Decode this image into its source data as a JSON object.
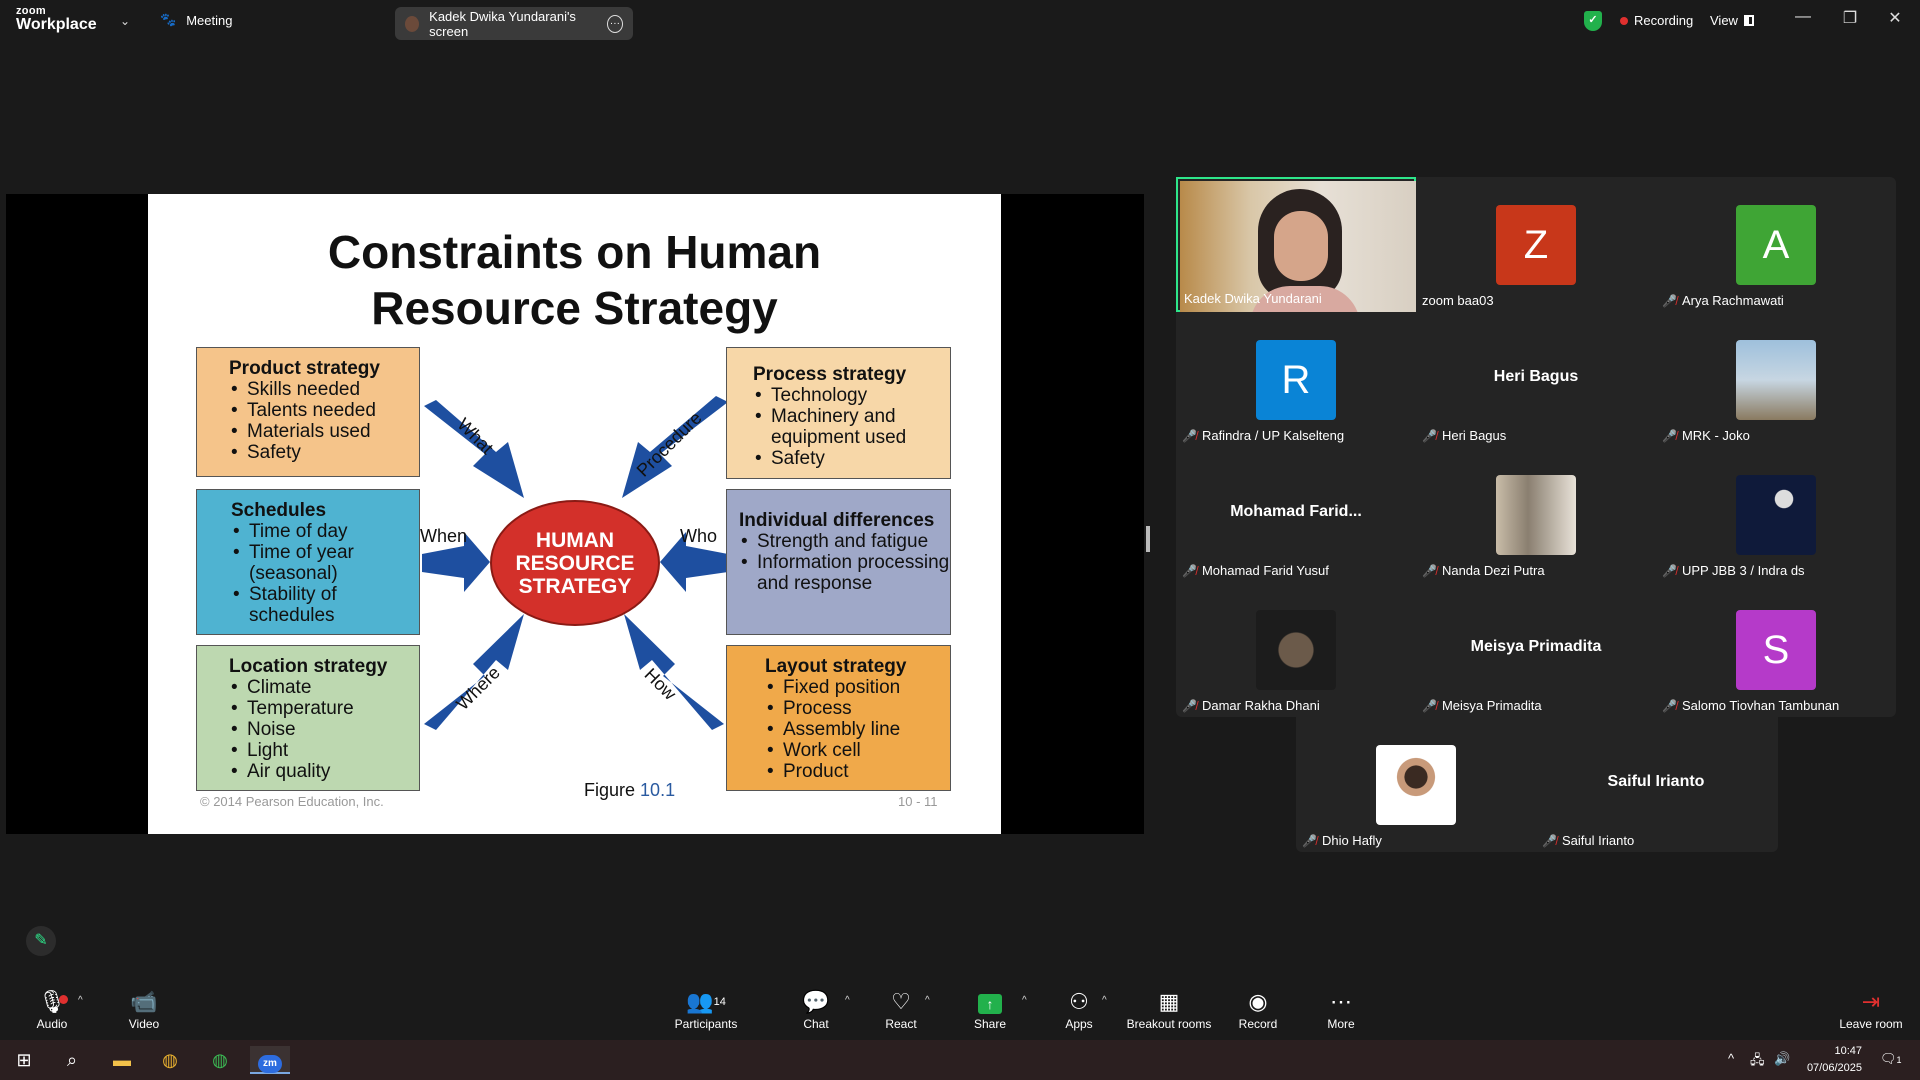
{
  "app": {
    "brand_top": "zoom",
    "brand_bottom": "Workplace",
    "meeting_label": "Meeting",
    "screen_label": "Kadek Dwika Yundarani's screen",
    "recording_label": "Recording",
    "view_label": "View"
  },
  "slide": {
    "title_line1": "Constraints on Human",
    "title_line2": "Resource Strategy",
    "hub_line1": "HUMAN",
    "hub_line2": "RESOURCE",
    "hub_line3": "STRATEGY",
    "arrows": {
      "what": "What",
      "procedure": "Procedure",
      "when": "When",
      "who": "Who",
      "where": "Where",
      "how": "How"
    },
    "boxes": {
      "product": {
        "title": "Product strategy",
        "items": [
          "Skills needed",
          "Talents needed",
          "Materials used",
          "Safety"
        ]
      },
      "schedules": {
        "title": "Schedules",
        "items": [
          "Time of day",
          "Time of year (seasonal)",
          "Stability of schedules"
        ]
      },
      "location": {
        "title": "Location strategy",
        "items": [
          "Climate",
          "Temperature",
          "Noise",
          "Light",
          "Air quality"
        ]
      },
      "process": {
        "title": "Process strategy",
        "items": [
          "Technology",
          "Machinery and equipment used",
          "Safety"
        ]
      },
      "individual": {
        "title": "Individual differences",
        "items": [
          "Strength and fatigue",
          "Information processing and response"
        ]
      },
      "layout": {
        "title": "Layout strategy",
        "items": [
          "Fixed position",
          "Process",
          "Assembly line",
          "Work cell",
          "Product"
        ]
      }
    },
    "colors": {
      "product": "#f5c48a",
      "schedules": "#4fb3d1",
      "location": "#bdd8b0",
      "process": "#f7d7a8",
      "individual": "#9fa8c8",
      "layout": "#f0a94a",
      "hub": "#d3302a",
      "arrows": "#1e4fa0"
    },
    "copyright": "© 2014 Pearson Education, Inc.",
    "figure_label": "Figure",
    "figure_number": "10.1",
    "page": "10 - 11"
  },
  "participants": [
    {
      "name": "Kadek Dwika Yundarani",
      "type": "video",
      "muted": false
    },
    {
      "name": "zoom baa03",
      "type": "letter",
      "letter": "Z",
      "color": "#c8371a",
      "muted": false
    },
    {
      "name": "Arya Rachmawati",
      "type": "letter",
      "letter": "A",
      "color": "#3fa535",
      "muted": true
    },
    {
      "name": "Rafindra / UP Kalselteng",
      "type": "letter",
      "letter": "R",
      "color": "#0a84d6",
      "muted": true
    },
    {
      "name": "Heri Bagus",
      "type": "text",
      "display": "Heri Bagus",
      "muted": true
    },
    {
      "name": "MRK - Joko",
      "type": "photo",
      "photo_color": "#8fb0c8",
      "muted": true
    },
    {
      "name": "Mohamad Farid Yusuf",
      "type": "text",
      "display": "Mohamad  Farid...",
      "muted": true
    },
    {
      "name": "Nanda Dezi Putra",
      "type": "photo",
      "photo_color": "#b8ab98",
      "muted": true
    },
    {
      "name": "UPP JBB 3 / Indra ds",
      "type": "photo",
      "photo_color": "#0f1a3a",
      "muted": true
    },
    {
      "name": "Damar Rakha Dhani",
      "type": "photo",
      "photo_color": "#2a2a2a",
      "muted": true
    },
    {
      "name": "Meisya Primadita",
      "type": "text",
      "display": "Meisya Primadita",
      "muted": true
    },
    {
      "name": "Salomo Tiovhan Tambunan",
      "type": "letter",
      "letter": "S",
      "color": "#b53ac9",
      "muted": true
    },
    {
      "name": "Dhio Hafly",
      "type": "photo",
      "photo_color": "#e8e8e8",
      "muted": true
    },
    {
      "name": "Saiful Irianto",
      "type": "text",
      "display": "Saiful Irianto",
      "muted": true
    }
  ],
  "toolbar": {
    "audio": "Audio",
    "video": "Video",
    "participants": "Participants",
    "participants_count": "14",
    "chat": "Chat",
    "react": "React",
    "share": "Share",
    "apps": "Apps",
    "breakout": "Breakout rooms",
    "record": "Record",
    "more": "More",
    "leave": "Leave room"
  },
  "taskbar": {
    "time": "10:47",
    "date": "07/06/2025",
    "notifications": "1"
  }
}
